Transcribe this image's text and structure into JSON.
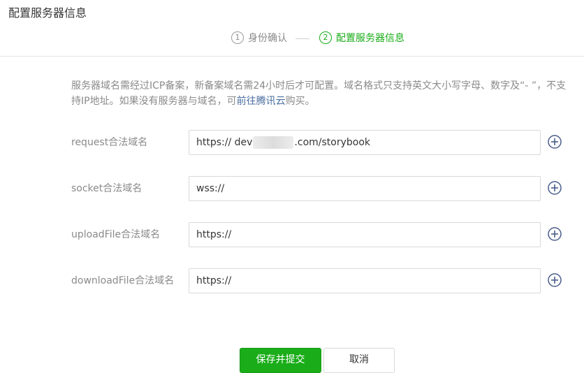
{
  "page": {
    "title": "配置服务器信息"
  },
  "steps": [
    {
      "num": "1",
      "label": "身份确认"
    },
    {
      "num": "2",
      "label": "配置服务器信息"
    }
  ],
  "note": {
    "text1": "服务器域名需经过ICP备案，新备案域名需24小时后才可配置。域名格式只支持英文大小写字母、数字及“- ”，不支持IP地址。如果没有服务器与域名，可",
    "link": "前往腾讯云",
    "text2": "购买。"
  },
  "fields": [
    {
      "label": "request合法域名",
      "prefix": "https:// dev",
      "suffix": ".com/storybook"
    },
    {
      "label": "socket合法域名",
      "value": "wss://"
    },
    {
      "label": "uploadFile合法域名",
      "value": "https://"
    },
    {
      "label": "downloadFile合法域名",
      "value": "https://"
    }
  ],
  "buttons": {
    "submit": "保存并提交",
    "cancel": "取消"
  },
  "colors": {
    "accent": "#1aad19",
    "link": "#4a6ea0",
    "icon": "#4a5d8a"
  },
  "icons": {
    "add": "plus-circle-icon"
  }
}
